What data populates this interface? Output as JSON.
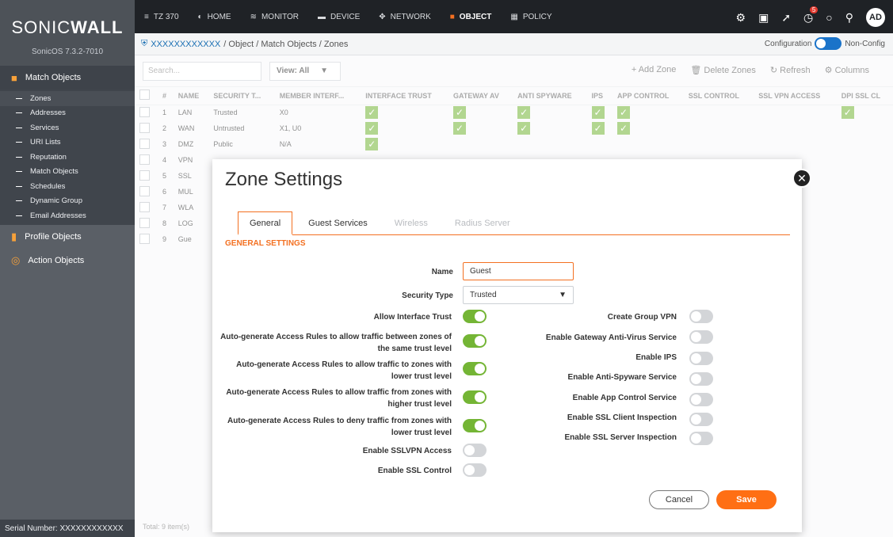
{
  "brand": {
    "logo_pre": "SONIC",
    "logo_bold": "WALL",
    "version": "SonicOS 7.3.2-7010"
  },
  "sidebar": {
    "sections": [
      {
        "label": "Match Objects"
      },
      {
        "label": "Profile Objects"
      },
      {
        "label": "Action Objects"
      }
    ],
    "items": [
      {
        "label": "Zones"
      },
      {
        "label": "Addresses"
      },
      {
        "label": "Services"
      },
      {
        "label": "URI Lists"
      },
      {
        "label": "Reputation"
      },
      {
        "label": "Match Objects"
      },
      {
        "label": "Schedules"
      },
      {
        "label": "Dynamic Group"
      },
      {
        "label": "Email Addresses"
      }
    ],
    "serial": "Serial Number: XXXXXXXXXXXX"
  },
  "topbar": {
    "device": "TZ 370",
    "nav": [
      "HOME",
      "MONITOR",
      "DEVICE",
      "NETWORK",
      "OBJECT",
      "POLICY"
    ],
    "notif_count": "5",
    "avatar": "AD"
  },
  "breadcrumb": {
    "device_id": "XXXXXXXXXXXX",
    "path": "/ Object / Match Objects / Zones"
  },
  "mode": {
    "left": "Configuration",
    "right": "Non-Config"
  },
  "toolbar": {
    "search_placeholder": "Search...",
    "view": "View: All",
    "add": "Add Zone",
    "delete": "Delete Zones",
    "refresh": "Refresh",
    "columns": "Columns"
  },
  "table": {
    "headers": [
      "#",
      "NAME",
      "SECURITY T...",
      "MEMBER INTERF...",
      "INTERFACE TRUST",
      "GATEWAY AV",
      "ANTI SPYWARE",
      "IPS",
      "APP CONTROL",
      "SSL CONTROL",
      "SSL VPN ACCESS",
      "DPI SSL CL"
    ],
    "rows": [
      {
        "num": "1",
        "name": "LAN",
        "type": "Trusted",
        "member": "X0"
      },
      {
        "num": "2",
        "name": "WAN",
        "type": "Untrusted",
        "member": "X1, U0"
      },
      {
        "num": "3",
        "name": "DMZ",
        "type": "Public",
        "member": "N/A"
      },
      {
        "num": "4",
        "name": "VPN",
        "type": "",
        "member": ""
      },
      {
        "num": "5",
        "name": "SSL",
        "type": "",
        "member": ""
      },
      {
        "num": "6",
        "name": "MUL",
        "type": "",
        "member": ""
      },
      {
        "num": "7",
        "name": "WLA",
        "type": "",
        "member": ""
      },
      {
        "num": "8",
        "name": "LOG",
        "type": "",
        "member": ""
      },
      {
        "num": "9",
        "name": "Gue",
        "type": "",
        "member": ""
      }
    ],
    "total": "Total: 9 item(s)"
  },
  "modal": {
    "title": "Zone Settings",
    "tabs": [
      "General",
      "Guest Services",
      "Wireless",
      "Radius Server"
    ],
    "section": "GENERAL SETTINGS",
    "name_label": "Name",
    "name_value": "Guest",
    "type_label": "Security Type",
    "type_value": "Trusted",
    "left_toggles": [
      {
        "label": "Allow Interface Trust",
        "on": true
      },
      {
        "label": "Auto-generate Access Rules to allow traffic between zones of the same trust level",
        "on": true
      },
      {
        "label": "Auto-generate Access Rules to allow traffic to zones with lower trust level",
        "on": true
      },
      {
        "label": "Auto-generate Access Rules to allow traffic from zones with higher trust level",
        "on": true
      },
      {
        "label": "Auto-generate Access Rules to deny traffic from zones with lower trust level",
        "on": true
      },
      {
        "label": "Enable SSLVPN Access",
        "on": false
      },
      {
        "label": "Enable SSL Control",
        "on": false
      }
    ],
    "right_toggles": [
      {
        "label": "Create Group VPN",
        "on": false
      },
      {
        "label": "Enable Gateway Anti-Virus Service",
        "on": false
      },
      {
        "label": "Enable IPS",
        "on": false
      },
      {
        "label": "Enable Anti-Spyware Service",
        "on": false
      },
      {
        "label": "Enable App Control Service",
        "on": false
      },
      {
        "label": "Enable SSL Client Inspection",
        "on": false
      },
      {
        "label": "Enable SSL Server Inspection",
        "on": false
      }
    ],
    "cancel": "Cancel",
    "save": "Save"
  }
}
